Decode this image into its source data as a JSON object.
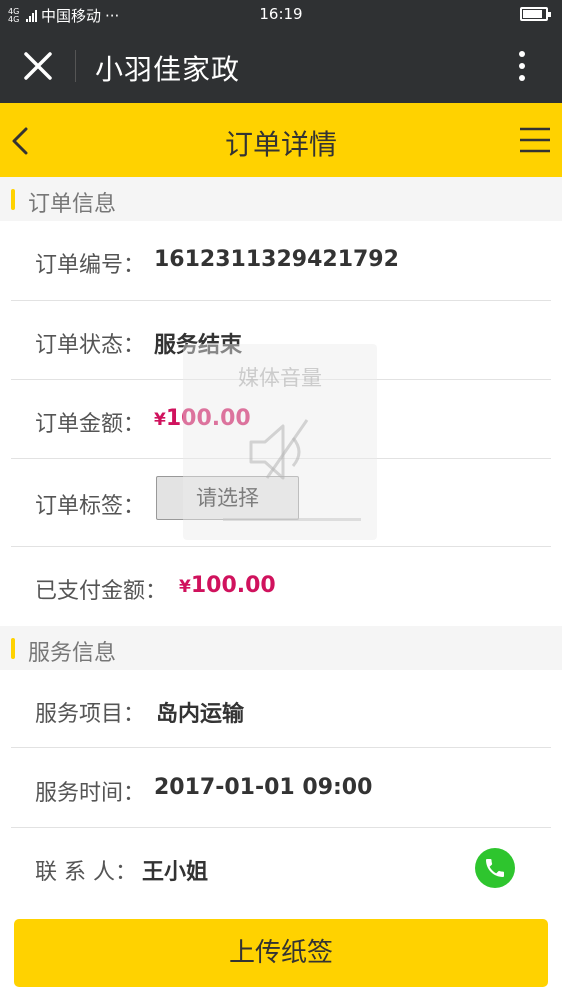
{
  "status_bar": {
    "network": "4G 4G",
    "carrier": "中国移动",
    "dots": "···",
    "time": "16:19",
    "battery_level": 0.85
  },
  "wechat_bar": {
    "title": "小羽佳家政"
  },
  "nav": {
    "title": "订单详情"
  },
  "order_section": {
    "title": "订单信息",
    "number_label": "订单编号：",
    "number_value": "1612311329421792",
    "status_label": "订单状态：",
    "status_value": "服务结束",
    "amount_label": "订单金额：",
    "amount_currency": "¥",
    "amount_value": "100.00",
    "tag_label": "订单标签：",
    "tag_select": "请选择",
    "paid_label": "已支付金额：",
    "paid_currency": "¥",
    "paid_value": "100.00"
  },
  "service_section": {
    "title": "服务信息",
    "item_label": "服务项目：",
    "item_value": "岛内运输",
    "time_label": "服务时间：",
    "time_value": "2017-01-01 09:00",
    "contact_label": "联 系 人：",
    "contact_value": "王小姐"
  },
  "volume_overlay": {
    "title": "媒体音量"
  },
  "footer": {
    "upload_label": "上传纸签"
  },
  "colors": {
    "accent": "#ffd200",
    "dark_bar": "#2f3133",
    "money": "#d0125d",
    "phone": "#2ec52e"
  }
}
